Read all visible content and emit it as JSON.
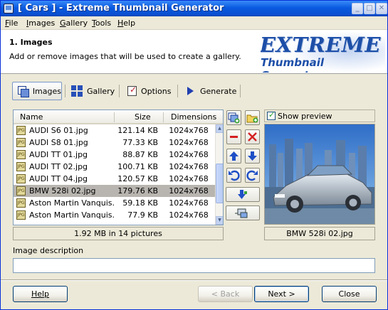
{
  "window": {
    "title": "[ Cars ] - Extreme Thumbnail Generator",
    "minimize": "_",
    "maximize": "□",
    "close": "✕"
  },
  "menu": [
    {
      "label": "File",
      "key": "F",
      "rest": "ile"
    },
    {
      "label": "Images",
      "key": "I",
      "rest": "mages"
    },
    {
      "label": "Gallery",
      "key": "G",
      "rest": "allery"
    },
    {
      "label": "Tools",
      "key": "T",
      "rest": "ools"
    },
    {
      "label": "Help",
      "key": "H",
      "rest": "elp"
    }
  ],
  "header": {
    "step_title": "1. Images",
    "description": "Add or remove images that will be used to create a gallery.",
    "logo_line1": "EXTREME",
    "logo_line2": "Thumbnail Generator"
  },
  "tabs": [
    {
      "label": "Images",
      "icon": "images-icon",
      "active": true
    },
    {
      "label": "Gallery",
      "icon": "gallery-grid-icon",
      "active": false
    },
    {
      "label": "Options",
      "icon": "options-checklist-icon",
      "active": false
    },
    {
      "label": "Generate",
      "icon": "generate-play-icon",
      "active": false
    }
  ],
  "list": {
    "columns": {
      "name": "Name",
      "size": "Size",
      "dimensions": "Dimensions"
    },
    "rows": [
      {
        "name": "AUDI S6 01.jpg",
        "size": "121.14 KB",
        "dimensions": "1024x768",
        "selected": false
      },
      {
        "name": "AUDI S8 01.jpg",
        "size": "77.33 KB",
        "dimensions": "1024x768",
        "selected": false
      },
      {
        "name": "AUDI TT 01.jpg",
        "size": "88.87 KB",
        "dimensions": "1024x768",
        "selected": false
      },
      {
        "name": "AUDI TT 02.jpg",
        "size": "100.71 KB",
        "dimensions": "1024x768",
        "selected": false
      },
      {
        "name": "AUDI TT 04.jpg",
        "size": "120.57 KB",
        "dimensions": "1024x768",
        "selected": false
      },
      {
        "name": "BMW 528i 02.jpg",
        "size": "179.76 KB",
        "dimensions": "1024x768",
        "selected": true
      },
      {
        "name": "Aston Martin Vanquis...",
        "size": "59.18 KB",
        "dimensions": "1024x768",
        "selected": false
      },
      {
        "name": "Aston Martin Vanquis...",
        "size": "77.9 KB",
        "dimensions": "1024x768",
        "selected": false
      }
    ],
    "file_icon_text": "JPG",
    "footer": "1.92 MB in 14 pictures"
  },
  "actions": {
    "add_images": "add-images-icon",
    "add_folder": "add-folder-icon",
    "remove": "remove-minus-icon",
    "clear": "clear-x-icon",
    "move_up": "move-up-icon",
    "move_down": "move-down-icon",
    "rotate_left": "rotate-left-icon",
    "rotate_right": "rotate-right-icon",
    "sort": "sort-icon",
    "properties": "image-properties-icon"
  },
  "preview": {
    "checkbox_label": "Show preview",
    "checked": true,
    "caption": "BMW 528i 02.jpg"
  },
  "description": {
    "label": "Image description",
    "value": "",
    "placeholder": ""
  },
  "buttons": {
    "help": "Help",
    "back": "< Back",
    "next": "Next >",
    "close": "Close"
  },
  "colors": {
    "titlebar": "#0a5ae0",
    "selected_row": "#b8b5b0",
    "logo_blue": "#1d4fa8",
    "dialog_bg": "#ece9d8"
  }
}
